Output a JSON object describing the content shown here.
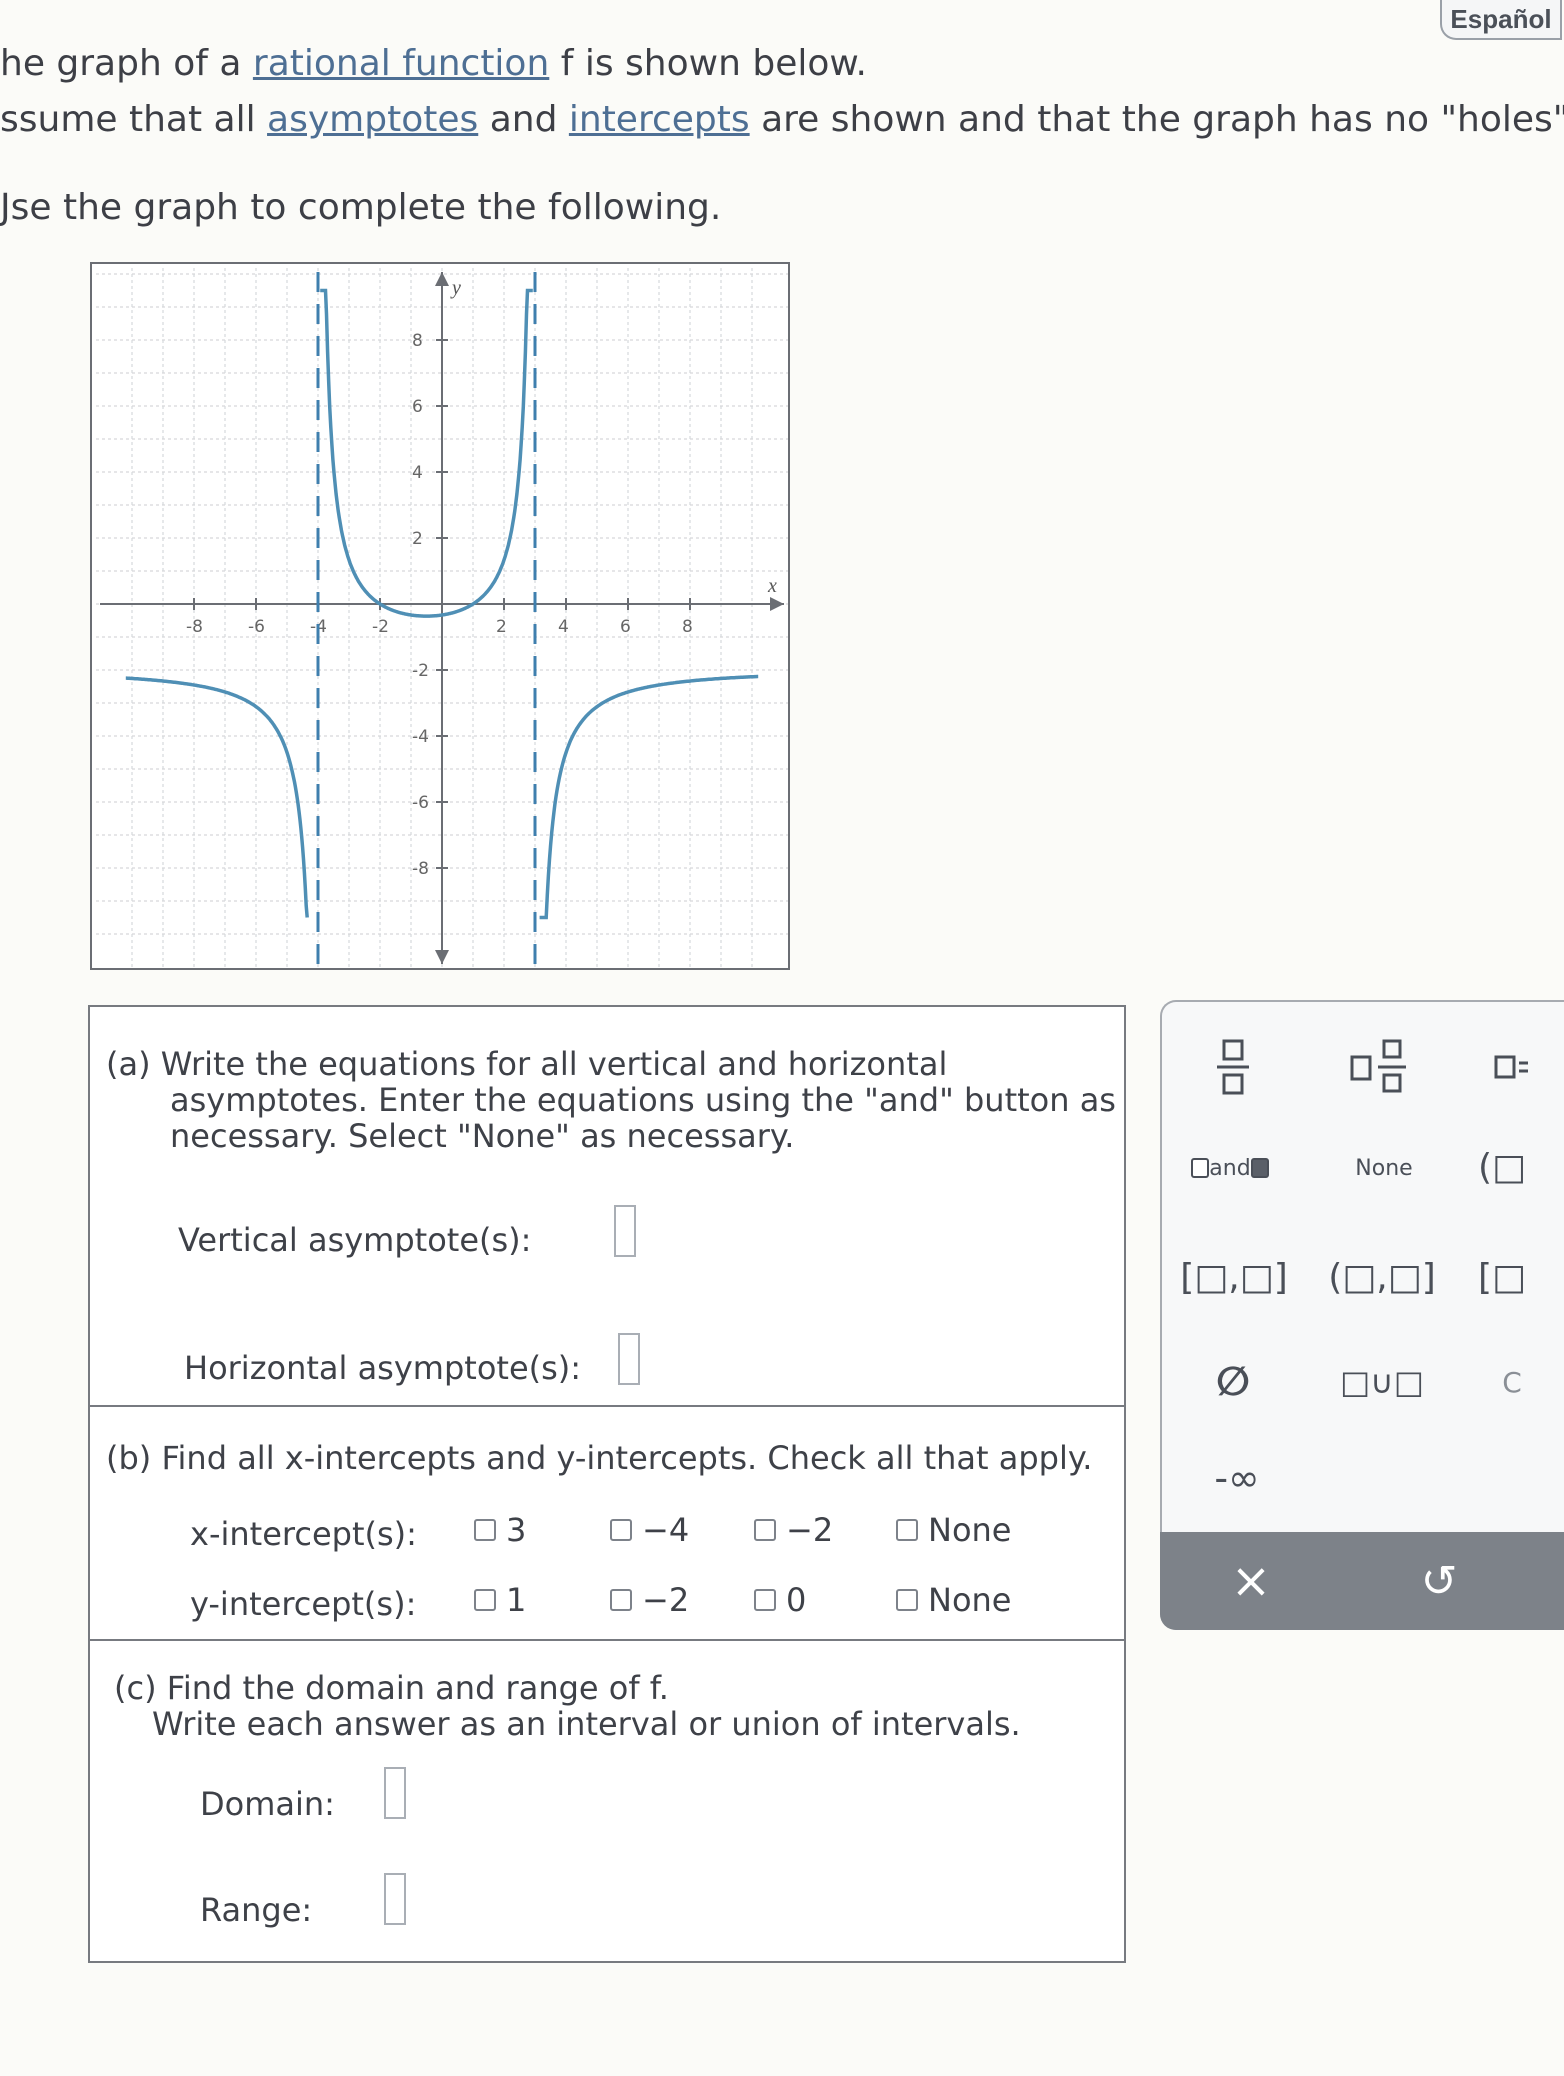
{
  "header": {
    "language_button": "Español"
  },
  "intro": {
    "line1_prefix": "he graph of a ",
    "line1_link": "rational function",
    "line1_suffix": " f is shown below.",
    "line2_prefix": "ssume that all ",
    "line2_link1": "asymptotes",
    "line2_mid": " and ",
    "line2_link2": "intercepts",
    "line2_suffix": " are shown and that the graph has no \"holes\".",
    "line3": "Jse the graph to complete the following."
  },
  "graph": {
    "x_axis_label": "x",
    "y_axis_label": "y",
    "x_ticks": [
      "-8",
      "-6",
      "-4",
      "-2",
      "2",
      "4",
      "6",
      "8"
    ],
    "y_ticks": [
      "8",
      "6",
      "4",
      "2",
      "-2",
      "-4",
      "-6",
      "-8"
    ],
    "vertical_asymptotes_x": [
      -4,
      3
    ],
    "horizontal_asymptote_y": -2,
    "x_range": [
      -10,
      10
    ],
    "y_range": [
      -10,
      10
    ],
    "curve_color": "#4f8fb5",
    "asymptote_color": "#3f7fae"
  },
  "part_a": {
    "prompt_line1": "(a) Write the equations for all vertical and horizontal",
    "prompt_line2": "asymptotes. Enter the equations using the \"and\" button as",
    "prompt_line3": "necessary. Select \"None\" as necessary.",
    "vertical_label": "Vertical asymptote(s):",
    "horizontal_label": "Horizontal asymptote(s):"
  },
  "part_b": {
    "prompt": "(b) Find all x-intercepts and y-intercepts. Check all that apply.",
    "x_label": "x-intercept(s):",
    "x_options": [
      "3",
      "−4",
      "−2",
      "None"
    ],
    "y_label": "y-intercept(s):",
    "y_options": [
      "1",
      "−2",
      "0",
      "None"
    ]
  },
  "part_c": {
    "prompt_line1": "(c) Find the domain and range of f.",
    "prompt_line2": "Write each answer as an interval or union of intervals.",
    "domain_label": "Domain:",
    "range_label": "Range:"
  },
  "keypad": {
    "and_label": "and",
    "none_label": "None",
    "closed_interval": "[□,□]",
    "half_open_interval": "(□,□]",
    "bracket_partial": "[□",
    "paren_partial": "(□",
    "empty_set": "∅",
    "union": "□∪□",
    "neg_infinity": "-∞",
    "partial_c": "C",
    "clear": "×",
    "undo": "↺"
  }
}
